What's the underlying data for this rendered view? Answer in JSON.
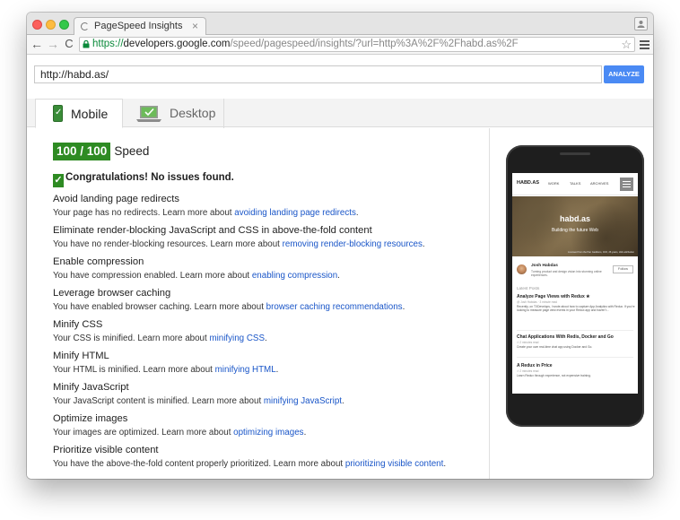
{
  "browser": {
    "tab_title": "PageSpeed Insights",
    "tab_close": "×",
    "url_secure": "https://",
    "url_host": "developers.google.com",
    "url_path": "/speed/pagespeed/insights/?url=http%3A%2F%2Fhabd.as%2F",
    "back": "←",
    "forward": "→",
    "reload": "C",
    "star": "☆"
  },
  "search": {
    "value": "http://habd.as/",
    "analyze_label": "ANALYZE"
  },
  "device_tabs": [
    {
      "label": "Mobile"
    },
    {
      "label": "Desktop"
    }
  ],
  "score": {
    "value": "100 / 100",
    "label": "Speed"
  },
  "congrats": "Congratulations! No issues found.",
  "rules": [
    {
      "title": "Avoid landing page redirects",
      "desc": "Your page has no redirects. Learn more about ",
      "link": "avoiding landing page redirects",
      "end": "."
    },
    {
      "title": "Eliminate render-blocking JavaScript and CSS in above-the-fold content",
      "desc": "You have no render-blocking resources. Learn more about ",
      "link": "removing render-blocking resources",
      "end": "."
    },
    {
      "title": "Enable compression",
      "desc": "You have compression enabled. Learn more about ",
      "link": "enabling compression",
      "end": "."
    },
    {
      "title": "Leverage browser caching",
      "desc": "You have enabled browser caching. Learn more about ",
      "link": "browser caching recommendations",
      "end": "."
    },
    {
      "title": "Minify CSS",
      "desc": "Your CSS is minified. Learn more about ",
      "link": "minifying CSS",
      "end": "."
    },
    {
      "title": "Minify HTML",
      "desc": "Your HTML is minified. Learn more about ",
      "link": "minifying HTML",
      "end": "."
    },
    {
      "title": "Minify JavaScript",
      "desc": "Your JavaScript content is minified. Learn more about ",
      "link": "minifying JavaScript",
      "end": "."
    },
    {
      "title": "Optimize images",
      "desc": "Your images are optimized. Learn more about ",
      "link": "optimizing images",
      "end": "."
    },
    {
      "title": "Prioritize visible content",
      "desc": "You have the above-the-fold content properly prioritized. Learn more about ",
      "link": "prioritizing visible content",
      "end": "."
    }
  ],
  "preview": {
    "brand": "HABD.AS",
    "nav_links": [
      "WORK",
      "TALKS",
      "ARCHIVES"
    ],
    "hero_title": "habd.as",
    "hero_subtitle": "Building the future Web",
    "hero_credit": "Licensed from the Pan Geddons, CC0, 26 years, click attribution",
    "author_name": "Josh Habdas",
    "author_bio": "Turning product and design vision into stunning online experiences.",
    "follow_label": "Follow",
    "latest_label": "Latest Posts",
    "posts": [
      {
        "title": "Analyze Page Views with Redux ★",
        "meta": "@ Josh Habdas · 3 minute read",
        "excerpt": "Recently, on TXDevelops, I wrote about how to capture App Analytics with Redux. If you're looking to measure page view events in your Redux app and haven't..."
      },
      {
        "title": "Chat Applications With Redis, Docker and Go",
        "meta": "⏱ 2 minutes read",
        "excerpt": "Create your own real-time chat app using Docker and Go."
      },
      {
        "title": "A Redux in Price",
        "meta": "⏱ 2 minutes read",
        "excerpt": "Learn Redux through experience, not expensive training."
      }
    ]
  }
}
